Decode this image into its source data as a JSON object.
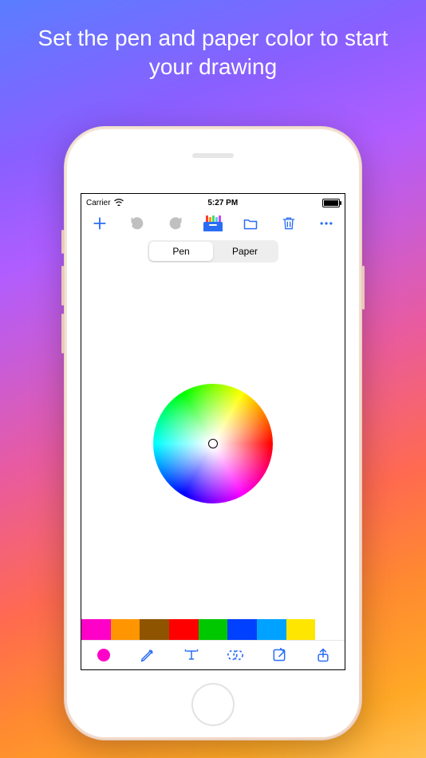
{
  "caption": "Set the pen and paper color to start your drawing",
  "status": {
    "carrier": "Carrier",
    "time": "5:27 PM"
  },
  "segmented": {
    "options": [
      "Pen",
      "Paper"
    ],
    "selected": 0
  },
  "palette_colors": [
    "#ff00c8",
    "#ff9500",
    "#8e5400",
    "#ff0000",
    "#00c800",
    "#0040ff",
    "#00a2ff",
    "#ffe600",
    "#ffffff"
  ],
  "toolbar": {
    "add": "add-button",
    "undo": "undo-button",
    "redo": "redo-button",
    "gallery": "gallery-button",
    "folder": "folder-button",
    "trash": "trash-button",
    "more": "more-button"
  },
  "bottom": {
    "color_fill": "#ff00c8",
    "tools": [
      "color",
      "pencil",
      "text",
      "lasso",
      "note",
      "share"
    ]
  },
  "accent": "#2a6df4"
}
